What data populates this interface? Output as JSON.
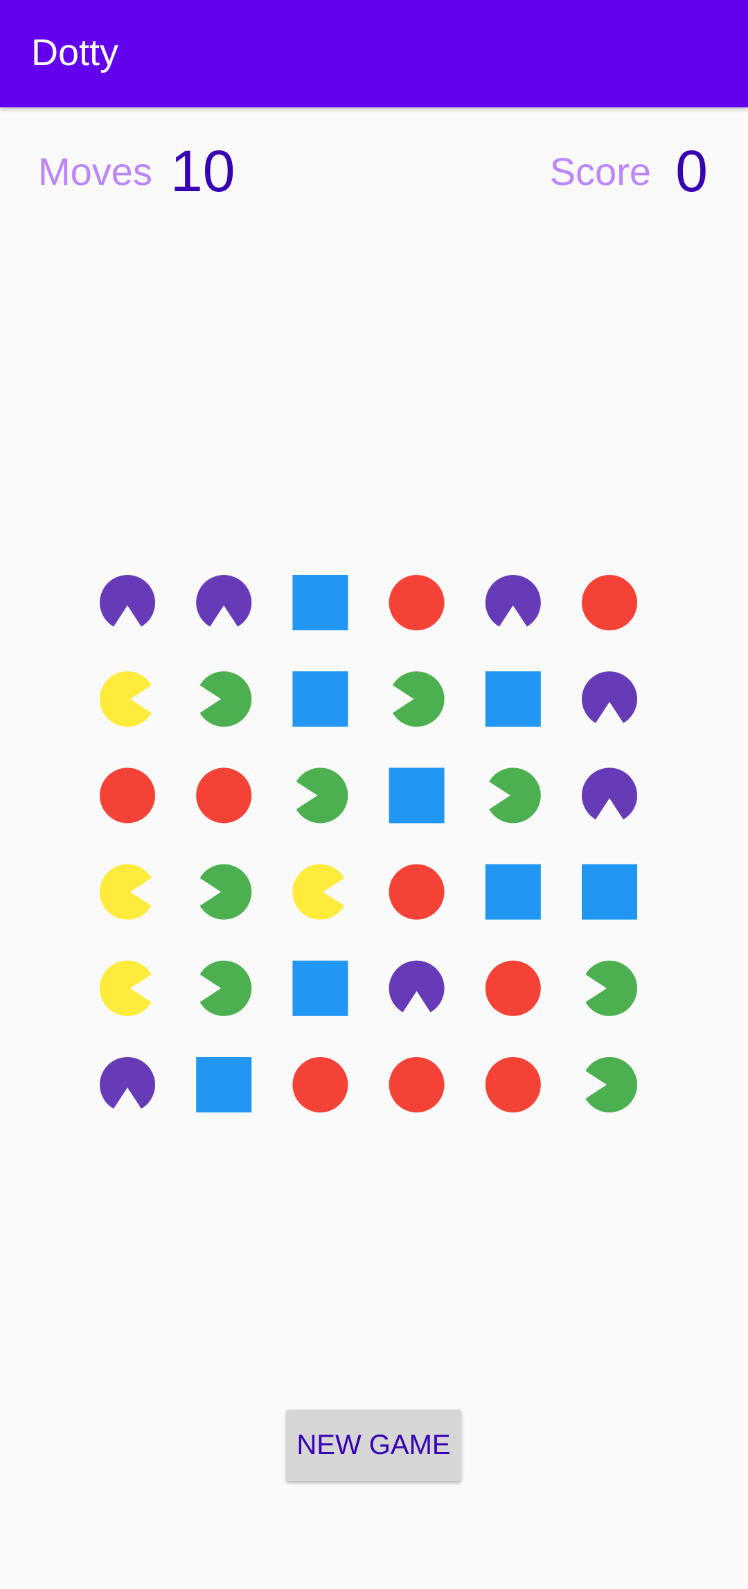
{
  "app_bar": {
    "title": "Dotty"
  },
  "stats": {
    "moves_label": "Moves",
    "moves_value": "10",
    "score_label": "Score",
    "score_value": "0"
  },
  "board": {
    "rows": 6,
    "cols": 6,
    "colors": {
      "purple": "#673ab7",
      "red": "#f44336",
      "blue": "#2196f3",
      "yellow": "#ffeb3b",
      "green": "#4caf50"
    },
    "cells": [
      [
        "purple-mouth-down",
        "purple-mouth-down",
        "blue-square",
        "red-circle",
        "purple-mouth-down",
        "red-circle"
      ],
      [
        "yellow-mouth-right",
        "green-mouth-left",
        "blue-square",
        "green-mouth-left",
        "blue-square",
        "purple-mouth-down"
      ],
      [
        "red-circle",
        "red-circle",
        "green-mouth-left",
        "blue-square",
        "green-mouth-left",
        "purple-mouth-down"
      ],
      [
        "yellow-mouth-right",
        "green-mouth-left",
        "yellow-mouth-right",
        "red-circle",
        "blue-square",
        "blue-square"
      ],
      [
        "yellow-mouth-right",
        "green-mouth-left",
        "blue-square",
        "purple-mouth-down",
        "red-circle",
        "green-mouth-left"
      ],
      [
        "purple-mouth-down",
        "blue-square",
        "red-circle",
        "red-circle",
        "red-circle",
        "green-mouth-left"
      ]
    ]
  },
  "actions": {
    "new_game_label": "NEW GAME"
  },
  "theme": {
    "primary": "#6200ee",
    "primary_dark": "#3700b3",
    "accent_label": "#bb86fc",
    "background": "#fafafa"
  }
}
